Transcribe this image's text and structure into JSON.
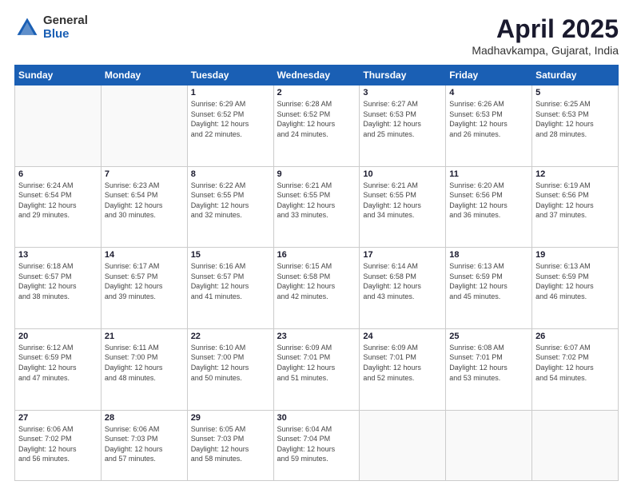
{
  "logo": {
    "general": "General",
    "blue": "Blue"
  },
  "header": {
    "month_year": "April 2025",
    "location": "Madhavkampa, Gujarat, India"
  },
  "days_of_week": [
    "Sunday",
    "Monday",
    "Tuesday",
    "Wednesday",
    "Thursday",
    "Friday",
    "Saturday"
  ],
  "weeks": [
    [
      {
        "num": "",
        "info": ""
      },
      {
        "num": "",
        "info": ""
      },
      {
        "num": "1",
        "info": "Sunrise: 6:29 AM\nSunset: 6:52 PM\nDaylight: 12 hours\nand 22 minutes."
      },
      {
        "num": "2",
        "info": "Sunrise: 6:28 AM\nSunset: 6:52 PM\nDaylight: 12 hours\nand 24 minutes."
      },
      {
        "num": "3",
        "info": "Sunrise: 6:27 AM\nSunset: 6:53 PM\nDaylight: 12 hours\nand 25 minutes."
      },
      {
        "num": "4",
        "info": "Sunrise: 6:26 AM\nSunset: 6:53 PM\nDaylight: 12 hours\nand 26 minutes."
      },
      {
        "num": "5",
        "info": "Sunrise: 6:25 AM\nSunset: 6:53 PM\nDaylight: 12 hours\nand 28 minutes."
      }
    ],
    [
      {
        "num": "6",
        "info": "Sunrise: 6:24 AM\nSunset: 6:54 PM\nDaylight: 12 hours\nand 29 minutes."
      },
      {
        "num": "7",
        "info": "Sunrise: 6:23 AM\nSunset: 6:54 PM\nDaylight: 12 hours\nand 30 minutes."
      },
      {
        "num": "8",
        "info": "Sunrise: 6:22 AM\nSunset: 6:55 PM\nDaylight: 12 hours\nand 32 minutes."
      },
      {
        "num": "9",
        "info": "Sunrise: 6:21 AM\nSunset: 6:55 PM\nDaylight: 12 hours\nand 33 minutes."
      },
      {
        "num": "10",
        "info": "Sunrise: 6:21 AM\nSunset: 6:55 PM\nDaylight: 12 hours\nand 34 minutes."
      },
      {
        "num": "11",
        "info": "Sunrise: 6:20 AM\nSunset: 6:56 PM\nDaylight: 12 hours\nand 36 minutes."
      },
      {
        "num": "12",
        "info": "Sunrise: 6:19 AM\nSunset: 6:56 PM\nDaylight: 12 hours\nand 37 minutes."
      }
    ],
    [
      {
        "num": "13",
        "info": "Sunrise: 6:18 AM\nSunset: 6:57 PM\nDaylight: 12 hours\nand 38 minutes."
      },
      {
        "num": "14",
        "info": "Sunrise: 6:17 AM\nSunset: 6:57 PM\nDaylight: 12 hours\nand 39 minutes."
      },
      {
        "num": "15",
        "info": "Sunrise: 6:16 AM\nSunset: 6:57 PM\nDaylight: 12 hours\nand 41 minutes."
      },
      {
        "num": "16",
        "info": "Sunrise: 6:15 AM\nSunset: 6:58 PM\nDaylight: 12 hours\nand 42 minutes."
      },
      {
        "num": "17",
        "info": "Sunrise: 6:14 AM\nSunset: 6:58 PM\nDaylight: 12 hours\nand 43 minutes."
      },
      {
        "num": "18",
        "info": "Sunrise: 6:13 AM\nSunset: 6:59 PM\nDaylight: 12 hours\nand 45 minutes."
      },
      {
        "num": "19",
        "info": "Sunrise: 6:13 AM\nSunset: 6:59 PM\nDaylight: 12 hours\nand 46 minutes."
      }
    ],
    [
      {
        "num": "20",
        "info": "Sunrise: 6:12 AM\nSunset: 6:59 PM\nDaylight: 12 hours\nand 47 minutes."
      },
      {
        "num": "21",
        "info": "Sunrise: 6:11 AM\nSunset: 7:00 PM\nDaylight: 12 hours\nand 48 minutes."
      },
      {
        "num": "22",
        "info": "Sunrise: 6:10 AM\nSunset: 7:00 PM\nDaylight: 12 hours\nand 50 minutes."
      },
      {
        "num": "23",
        "info": "Sunrise: 6:09 AM\nSunset: 7:01 PM\nDaylight: 12 hours\nand 51 minutes."
      },
      {
        "num": "24",
        "info": "Sunrise: 6:09 AM\nSunset: 7:01 PM\nDaylight: 12 hours\nand 52 minutes."
      },
      {
        "num": "25",
        "info": "Sunrise: 6:08 AM\nSunset: 7:01 PM\nDaylight: 12 hours\nand 53 minutes."
      },
      {
        "num": "26",
        "info": "Sunrise: 6:07 AM\nSunset: 7:02 PM\nDaylight: 12 hours\nand 54 minutes."
      }
    ],
    [
      {
        "num": "27",
        "info": "Sunrise: 6:06 AM\nSunset: 7:02 PM\nDaylight: 12 hours\nand 56 minutes."
      },
      {
        "num": "28",
        "info": "Sunrise: 6:06 AM\nSunset: 7:03 PM\nDaylight: 12 hours\nand 57 minutes."
      },
      {
        "num": "29",
        "info": "Sunrise: 6:05 AM\nSunset: 7:03 PM\nDaylight: 12 hours\nand 58 minutes."
      },
      {
        "num": "30",
        "info": "Sunrise: 6:04 AM\nSunset: 7:04 PM\nDaylight: 12 hours\nand 59 minutes."
      },
      {
        "num": "",
        "info": ""
      },
      {
        "num": "",
        "info": ""
      },
      {
        "num": "",
        "info": ""
      }
    ]
  ]
}
